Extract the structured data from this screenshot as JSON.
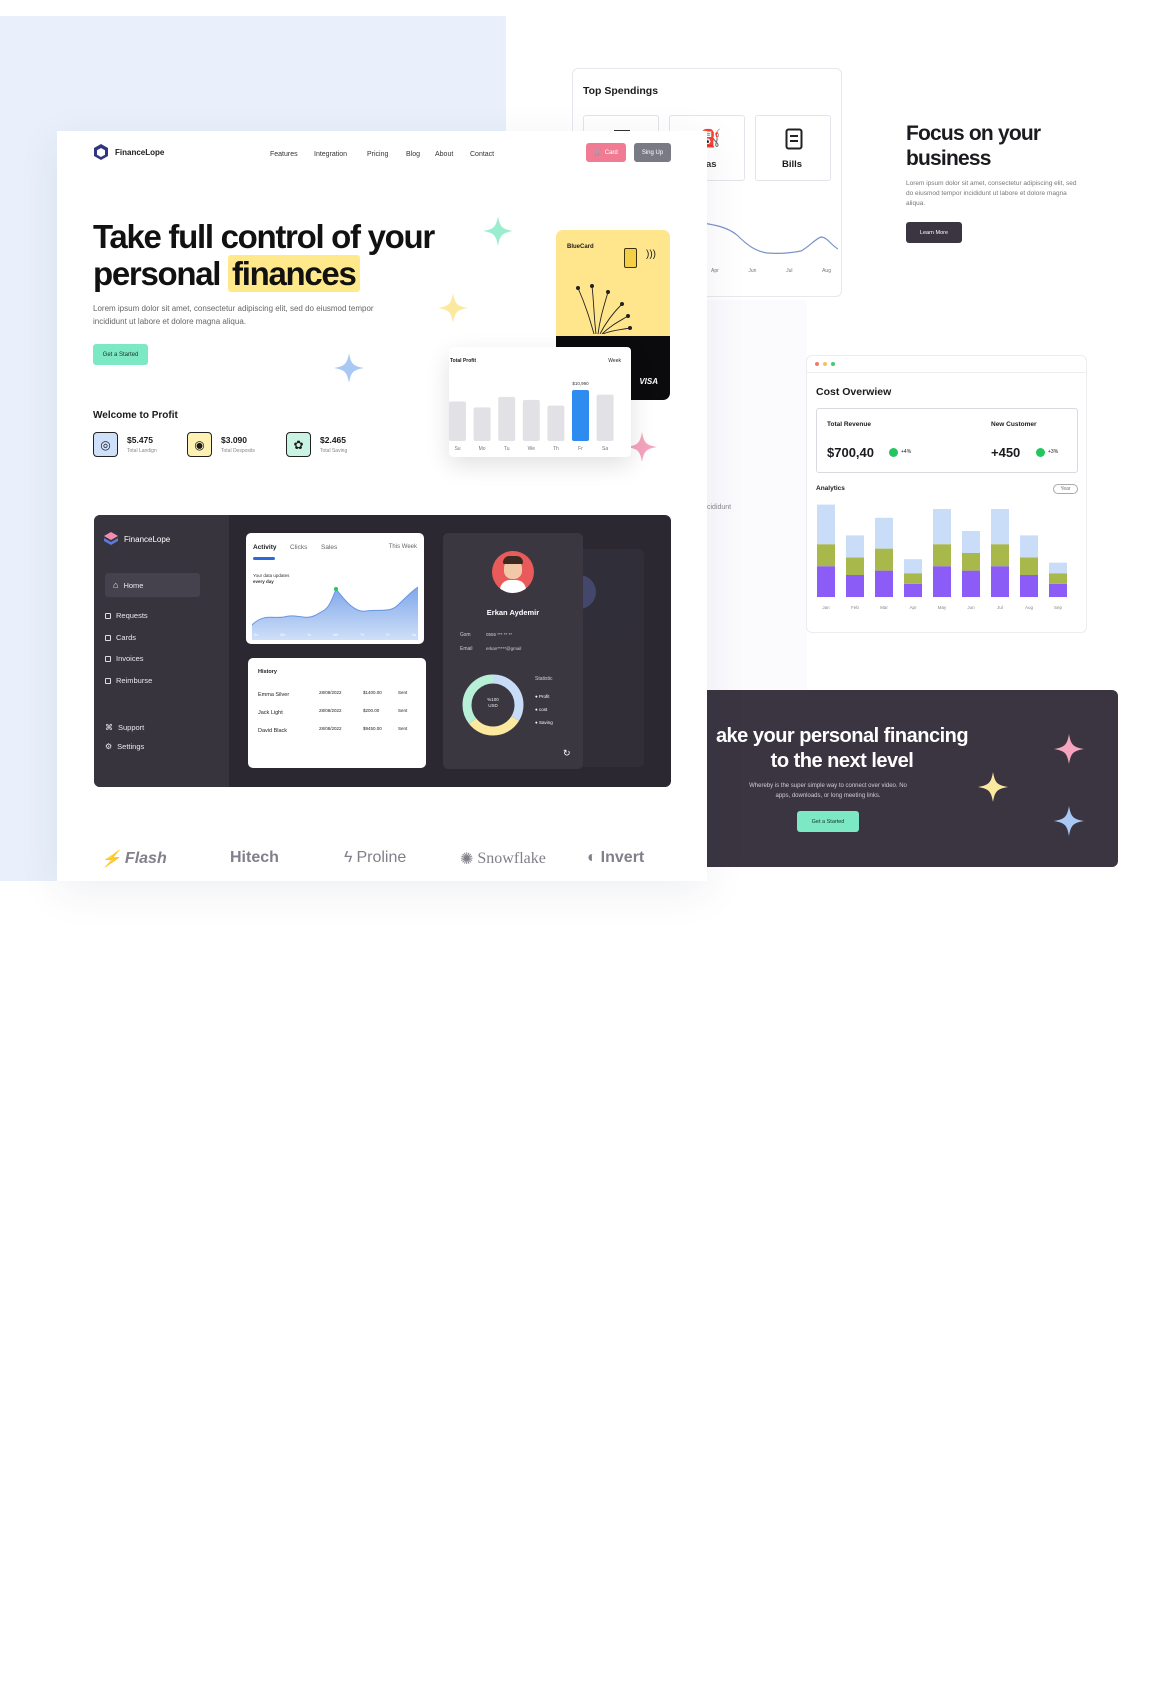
{
  "brand": {
    "name": "FinanceLope"
  },
  "nav": [
    "Features",
    "Integration",
    "Pricing",
    "Blog",
    "About",
    "Contact"
  ],
  "header_buttons": {
    "cart": "Card",
    "signup": "Sing Up"
  },
  "hero": {
    "title_line1": "Take full control of your",
    "title_line2_a": "personal",
    "title_line2_b": "finances",
    "lead": "Lorem ipsum dolor sit amet, consectetur adipiscing elit, sed do eiusmod tempor incididunt ut labore et dolore magna aliqua.",
    "cta": "Get a Started"
  },
  "welcome": {
    "title": "Welcome to Profit",
    "stats": [
      {
        "value": "$5.475",
        "label": "Total Landign",
        "icon": "target-icon",
        "color": "#cfe0fb"
      },
      {
        "value": "$3.090",
        "label": "Total Desposits",
        "icon": "coins-icon",
        "color": "#fff0b3"
      },
      {
        "value": "$2.465",
        "label": "Total Saving",
        "icon": "piggy-icon",
        "color": "#c9f3e2"
      }
    ]
  },
  "bluecard": {
    "name": "BlueCard",
    "network": "VISA"
  },
  "total_profit": {
    "title": "Total Profit",
    "period": "Week",
    "highlight": "$10,990",
    "chart_data": {
      "type": "bar",
      "categories": [
        "Su",
        "Mo",
        "Tu",
        "We",
        "Th",
        "Fr",
        "Sa"
      ],
      "values": [
        0.68,
        0.58,
        0.76,
        0.71,
        0.61,
        0.88,
        0.8
      ],
      "highlight_index": 5
    }
  },
  "dashboard": {
    "brand": "FinanceLope",
    "menu": [
      "Home",
      "Requests",
      "Cards",
      "Invoices",
      "Reimburse"
    ],
    "menu_bottom": [
      "Support",
      "Settings"
    ],
    "activity": {
      "tabs": [
        "Activity",
        "Clicks",
        "Sales"
      ],
      "period": "This Week",
      "note_line1": "Your data updates",
      "note_line2": "every day",
      "days": [
        "Su",
        "Mo",
        "Tu",
        "We",
        "Th",
        "Fr",
        "Sa"
      ]
    },
    "history": {
      "title": "History",
      "rows": [
        {
          "name": "Emma Silver",
          "date": "28/08/2022",
          "amount": "$1400.00",
          "status": "Sent"
        },
        {
          "name": "Jack Light",
          "date": "28/08/2022",
          "amount": "$200.00",
          "status": "Sent"
        },
        {
          "name": "David Black",
          "date": "28/08/2022",
          "amount": "$9450.00",
          "status": "Sent"
        }
      ]
    },
    "profile": {
      "name": "Erkan Aydemir",
      "gsm_label": "Gsm",
      "gsm_value": "0555 *** ** **",
      "email_label": "Email",
      "email_value": "erkan*****@gmail",
      "donut_center_line1": "%100",
      "donut_center_line2": "USD",
      "statistic_title": "Statistic",
      "legend": [
        "Profit",
        "cost",
        "Saving"
      ]
    }
  },
  "logos": [
    "Flash",
    "Hitech",
    "Proline",
    "Snowflake",
    "Invert"
  ],
  "spendings": {
    "title": "Top Spendings",
    "tiles": [
      "",
      "as",
      "Bills"
    ],
    "months": [
      "Apr",
      "Jun",
      "Jul",
      "Aug"
    ]
  },
  "focus": {
    "title_line1": "Focus on your",
    "title_line2": "business",
    "text": "Lorem ipsum dolor sit amet, consectetur adipiscing elit, sed do eiusmod tempor incididunt ut labore et dolore magna aliqua.",
    "cta": "Learn More"
  },
  "fragment_text": "cididunt",
  "cost": {
    "title": "Cost Overwiew",
    "revenue_label": "Total Revenue",
    "revenue_value": "$700,40",
    "revenue_delta": "+4%",
    "customer_label": "New Customer",
    "customer_value": "+450",
    "customer_delta": "+3%",
    "analytics": "Analytics",
    "range": "Year",
    "chart_data": {
      "type": "bar",
      "stacked": true,
      "categories": [
        "Jan",
        "Feb",
        "Mar",
        "Apr",
        "May",
        "Jun",
        "Jul",
        "Aug",
        "Sep"
      ],
      "series": [
        {
          "values": [
            3.5,
            2.5,
            3.0,
            1.5,
            3.5,
            3.0,
            3.5,
            2.5,
            1.5
          ],
          "color": "#8b5cf6"
        },
        {
          "values": [
            2.5,
            2.0,
            2.5,
            1.2,
            2.5,
            2.0,
            2.5,
            2.0,
            1.2
          ],
          "color": "#a8b84a"
        },
        {
          "values": [
            4.5,
            2.5,
            3.5,
            1.6,
            4.0,
            2.5,
            4.0,
            2.5,
            1.2
          ],
          "color": "#c9ddf9"
        }
      ]
    }
  },
  "cta_banner": {
    "line1": "ake your personal financing",
    "line2": "to the next level",
    "text_line1": "Whereby is the super simple way to connect over video. No",
    "text_line2": "apps, downloads, or long meeting links.",
    "button": "Get a Started"
  }
}
